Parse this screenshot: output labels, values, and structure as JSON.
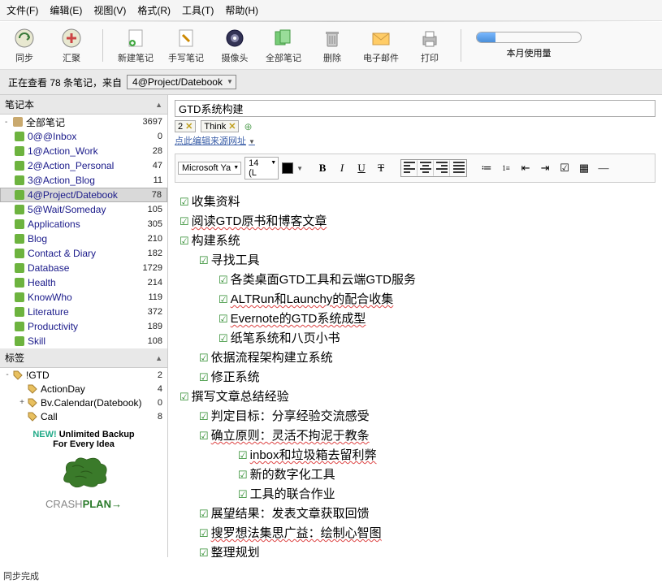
{
  "menu": [
    "文件(F)",
    "编辑(E)",
    "视图(V)",
    "格式(R)",
    "工具(T)",
    "帮助(H)"
  ],
  "toolbar": [
    {
      "label": "同步",
      "icon": "sync"
    },
    {
      "label": "汇聚",
      "icon": "plus"
    },
    {
      "label": "新建笔记",
      "icon": "new",
      "sep_before": true
    },
    {
      "label": "手写笔记",
      "icon": "hand"
    },
    {
      "label": "摄像头",
      "icon": "cam"
    },
    {
      "label": "全部笔记",
      "icon": "all"
    },
    {
      "label": "删除",
      "icon": "del"
    },
    {
      "label": "电子邮件",
      "icon": "mail"
    },
    {
      "label": "打印",
      "icon": "print"
    }
  ],
  "usage_label": "本月使用量",
  "context": {
    "prefix": "正在查看 78 条笔记，来自",
    "select": "4@Project/Datebook"
  },
  "sidebar": {
    "nb_header": "笔记本",
    "notebooks": [
      {
        "name": "全部笔记",
        "count": 3697,
        "root": true
      },
      {
        "name": "0@@Inbox",
        "count": 0
      },
      {
        "name": "1@Action_Work",
        "count": 28
      },
      {
        "name": "2@Action_Personal",
        "count": 47
      },
      {
        "name": "3@Action_Blog",
        "count": 11
      },
      {
        "name": "4@Project/Datebook",
        "count": 78,
        "selected": true
      },
      {
        "name": "5@Wait/Someday",
        "count": 105
      },
      {
        "name": "Applications",
        "count": 305
      },
      {
        "name": "Blog",
        "count": 210
      },
      {
        "name": "Contact & Diary",
        "count": 182
      },
      {
        "name": "Database",
        "count": 1729
      },
      {
        "name": "Health",
        "count": 214
      },
      {
        "name": "KnowWho",
        "count": 119
      },
      {
        "name": "Literature",
        "count": 372
      },
      {
        "name": "Productivity",
        "count": 189
      },
      {
        "name": "Skill",
        "count": 108
      }
    ],
    "tag_header": "标签",
    "tags": [
      {
        "name": "!GTD",
        "count": 2,
        "level": 0,
        "exp": "-"
      },
      {
        "name": "ActionDay",
        "count": 4,
        "level": 1
      },
      {
        "name": "Bv.Calendar(Datebook)",
        "count": 0,
        "level": 1,
        "exp": "+"
      },
      {
        "name": "Call",
        "count": 8,
        "level": 1
      }
    ],
    "promo": {
      "new": "NEW!",
      "line1": "Unlimited Backup",
      "line2": "For Every Idea",
      "brand1": "CRASH",
      "brand2": "PLAN→"
    }
  },
  "status": "同步完成",
  "note": {
    "title": "GTD系统构建",
    "tagchips": [
      "2",
      "Think"
    ],
    "source_link": "点此编辑来源网址",
    "font": "Microsoft Ya",
    "size": "14 (L",
    "lines": [
      {
        "lev": 0,
        "txt": "收集资料"
      },
      {
        "lev": 0,
        "txt": "阅读GTD原书和博客文章",
        "w": 1
      },
      {
        "lev": 0,
        "txt": "构建系统"
      },
      {
        "lev": 1,
        "txt": "寻找工具"
      },
      {
        "lev": 2,
        "txt": "各类桌面GTD工具和云端GTD服务"
      },
      {
        "lev": 2,
        "txt": "ALTRun和Launchy的配合收集",
        "w": 1
      },
      {
        "lev": 2,
        "txt": "Evernote的GTD系统成型",
        "w": 1
      },
      {
        "lev": 2,
        "txt": "纸笔系统和八页小书"
      },
      {
        "lev": 1,
        "txt": "依据流程架构建立系统"
      },
      {
        "lev": 1,
        "txt": "修正系统"
      },
      {
        "lev": 0,
        "txt": "撰写文章总结经验"
      },
      {
        "lev": 1,
        "txt": "判定目标：分享经验交流感受"
      },
      {
        "lev": 1,
        "txt": "确立原则：灵活不拘泥于教条",
        "w": 1
      },
      {
        "lev": 3,
        "txt": "inbox和垃圾箱去留利弊",
        "w": 1
      },
      {
        "lev": 3,
        "txt": "新的数字化工具"
      },
      {
        "lev": 3,
        "txt": "工具的联合作业"
      },
      {
        "lev": 1,
        "txt": "展望结果：发表文章获取回馈"
      },
      {
        "lev": 1,
        "txt": "搜罗想法集思广益：绘制心智图",
        "w": 1
      },
      {
        "lev": 1,
        "txt": "整理规划"
      }
    ]
  }
}
